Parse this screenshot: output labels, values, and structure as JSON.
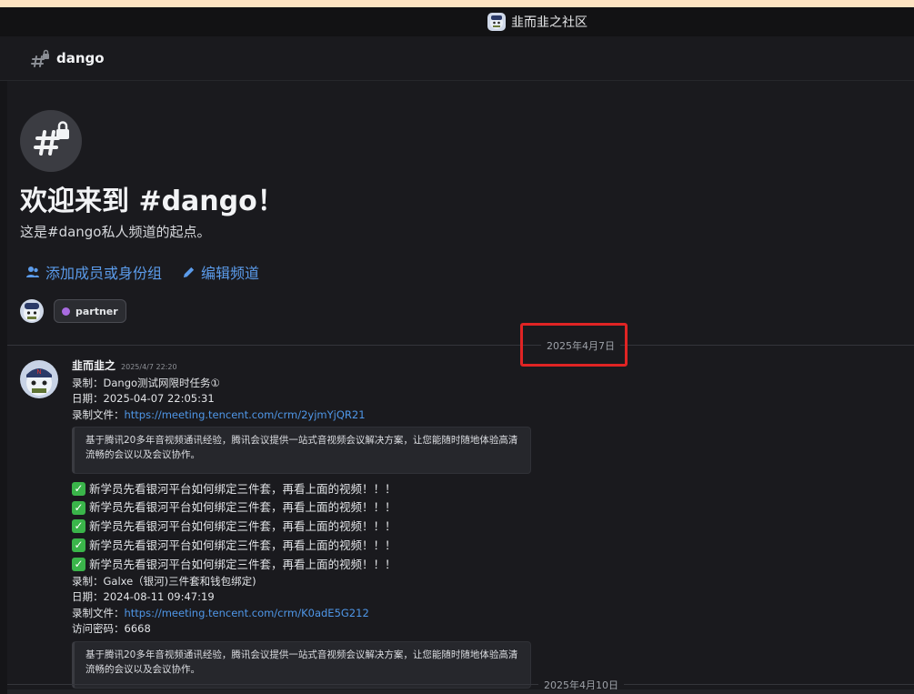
{
  "server": {
    "name": "韭而韭之社区",
    "icon": "avatar-icon"
  },
  "channel": {
    "name": "dango",
    "icon": "hash-lock-icon"
  },
  "welcome": {
    "title": "欢迎来到 #dango！",
    "subtitle": "这是#dango私人频道的起点。",
    "add_members_label": "添加成员或身份组",
    "edit_channel_label": "编辑频道",
    "role_badge": "partner",
    "role_color": "#a86be0"
  },
  "dividers": {
    "date1": "2025年4月7日",
    "date2": "2025年4月10日"
  },
  "message": {
    "author": "韭而韭之",
    "timestamp": "2025/4/7 22:20",
    "line1": "录制：Dango测试网限时任务①",
    "line2": "日期：2025-04-07 22:05:31",
    "line3_prefix": "录制文件：",
    "link1": "https://meeting.tencent.com/crm/2yjmYjQR21",
    "embed1": "基于腾讯20多年音视频通讯经验，腾讯会议提供一站式音视频会议解决方案，让您能随时随地体验高清流畅的会议以及会议协作。",
    "check_lines": [
      "新学员先看银河平台如何绑定三件套，再看上面的视频！！！",
      "新学员先看银河平台如何绑定三件套，再看上面的视频！！！",
      "新学员先看银河平台如何绑定三件套，再看上面的视频！！！",
      "新学员先看银河平台如何绑定三件套，再看上面的视频！！！",
      "新学员先看银河平台如何绑定三件套，再看上面的视频！！！"
    ],
    "line4": "录制：Galxe（银河)三件套和钱包绑定)",
    "line5": "日期：2024-08-11 09:47:19",
    "line6_prefix": "录制文件：",
    "link2": "https://meeting.tencent.com/crm/K0adE5G212",
    "line7": "访问密码：6668",
    "embed2": "基于腾讯20多年音视频通讯经验，腾讯会议提供一站式音视频会议解决方案，让您能随时随地体验高清流畅的会议以及会议协作。"
  },
  "colors": {
    "accent": "#5b9bea",
    "link": "#4f97e8",
    "highlight": "#e02424",
    "check": "#3ab54a"
  }
}
